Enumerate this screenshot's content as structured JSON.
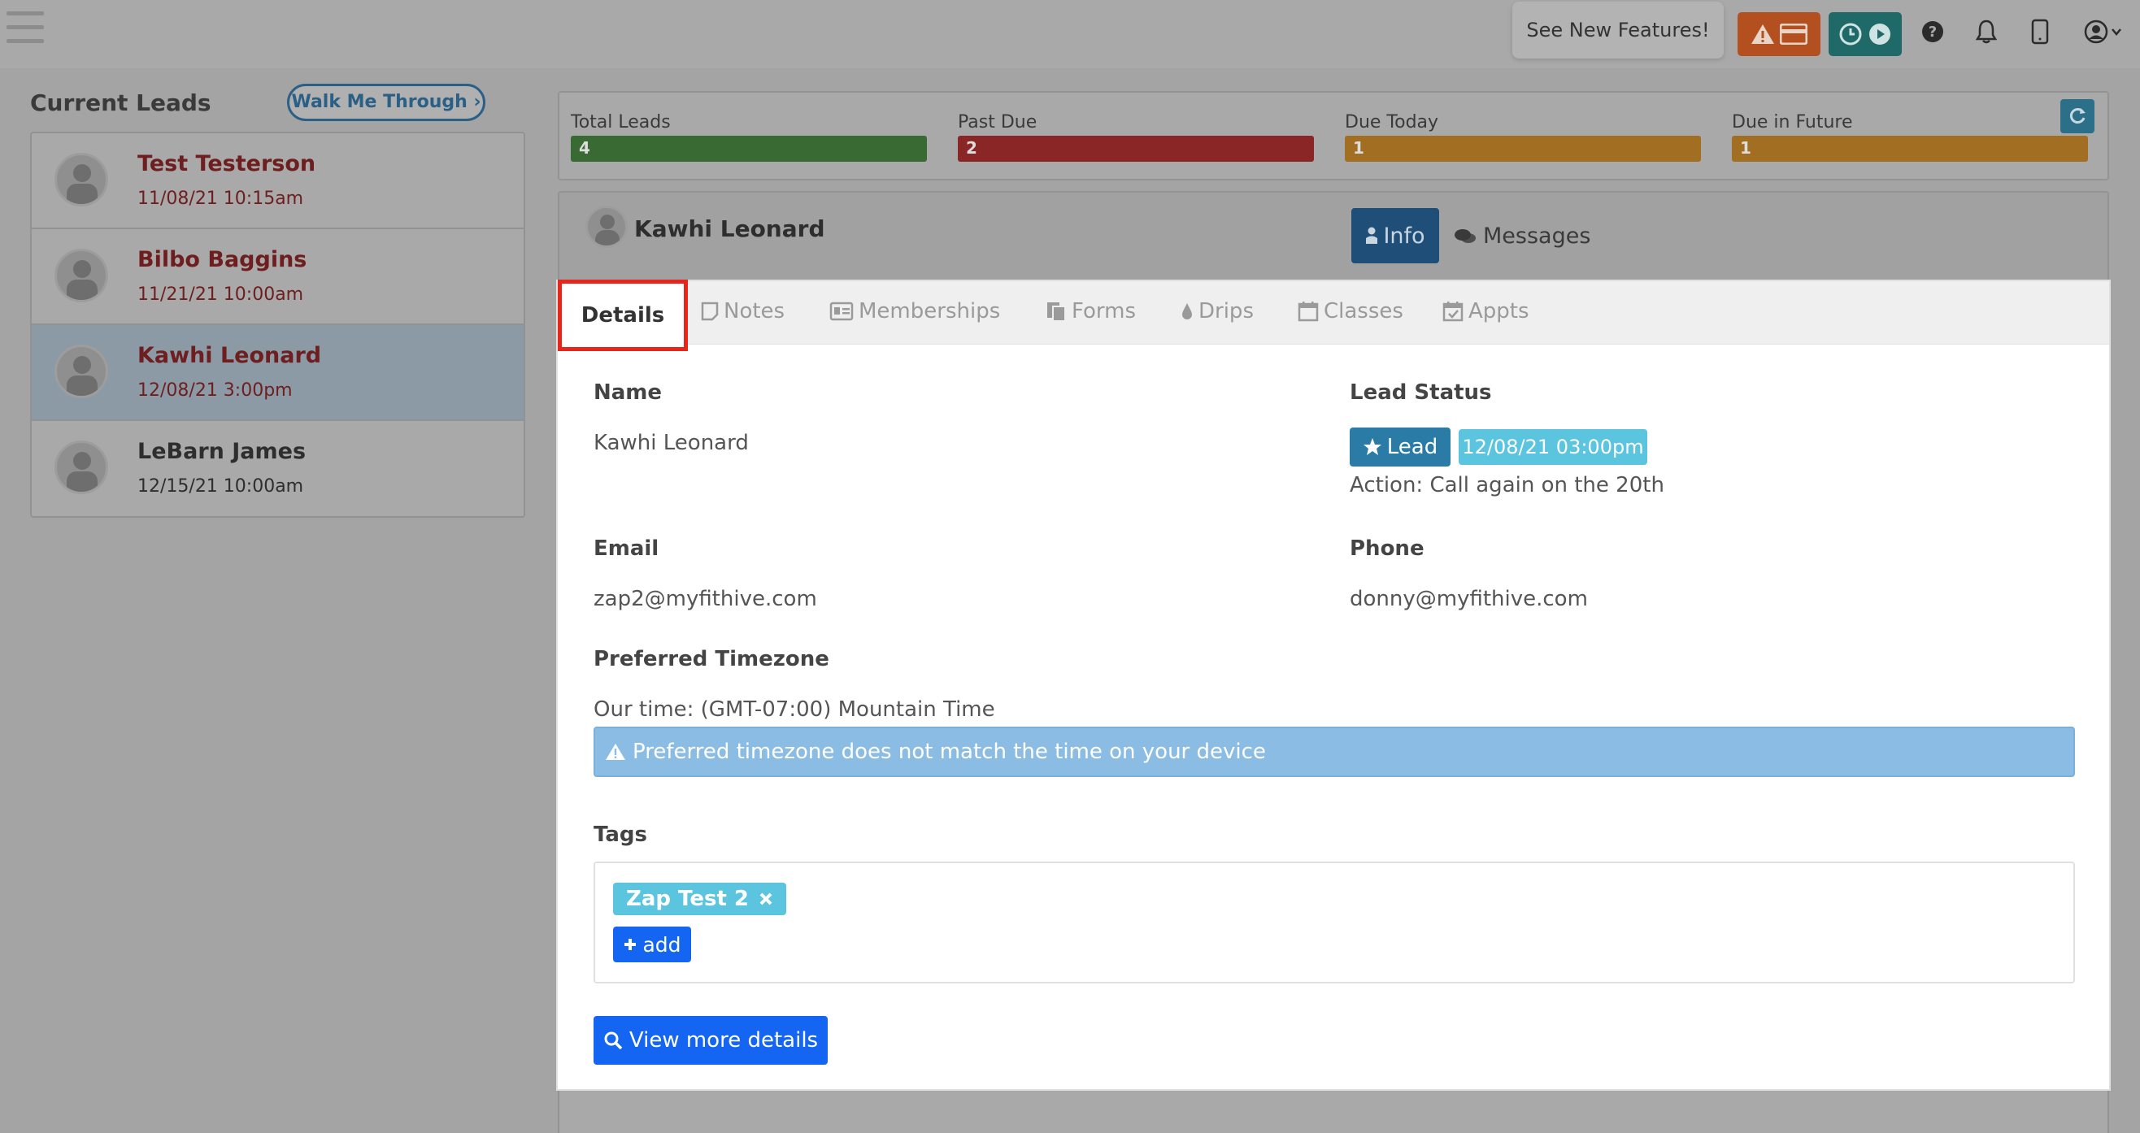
{
  "topbar": {
    "features_label": "See New Features!"
  },
  "leads": {
    "title": "Current Leads",
    "walk_label": "Walk Me Through ›",
    "items": [
      {
        "name": "Test Testerson",
        "date": "11/08/21 10:15am"
      },
      {
        "name": "Bilbo Baggins",
        "date": "11/21/21 10:00am"
      },
      {
        "name": "Kawhi Leonard",
        "date": "12/08/21 3:00pm"
      },
      {
        "name": "LeBarn James",
        "date": "12/15/21 10:00am"
      }
    ]
  },
  "stats": [
    {
      "label": "Total Leads",
      "value": "4",
      "color": "#3a6a33"
    },
    {
      "label": "Past Due",
      "value": "2",
      "color": "#8a2626"
    },
    {
      "label": "Due Today",
      "value": "1",
      "color": "#a26f22"
    },
    {
      "label": "Due in Future",
      "value": "1",
      "color": "#a26f22"
    }
  ],
  "contact": {
    "name": "Kawhi Leonard",
    "info_label": "Info",
    "messages_label": "Messages"
  },
  "tabs": [
    {
      "label": "Details",
      "icon": "none"
    },
    {
      "label": "Notes",
      "icon": "note-icon"
    },
    {
      "label": "Memberships",
      "icon": "id-card-icon"
    },
    {
      "label": "Forms",
      "icon": "forms-icon"
    },
    {
      "label": "Drips",
      "icon": "drop-icon"
    },
    {
      "label": "Classes",
      "icon": "calendar-icon"
    },
    {
      "label": "Appts",
      "icon": "calendar-check-icon"
    }
  ],
  "details": {
    "name_label": "Name",
    "name_value": "Kawhi Leonard",
    "status_label": "Lead Status",
    "status_badge": "Lead",
    "status_date": "12/08/21 03:00pm",
    "status_action": "Action: Call again on the 20th",
    "email_label": "Email",
    "email_value": "zap2@myfithive.com",
    "phone_label": "Phone",
    "phone_value": "donny@myfithive.com",
    "tz_label": "Preferred Timezone",
    "tz_value": "Our time: (GMT-07:00) Mountain Time",
    "tz_alert": "Preferred timezone does not match the time on your device",
    "tags_label": "Tags",
    "tag": "Zap Test 2",
    "add_label": "add",
    "view_more_label": "View more details"
  },
  "colors": {
    "primary": "#1466f2",
    "info": "#5bc4de",
    "highlight": "#e8251b"
  }
}
